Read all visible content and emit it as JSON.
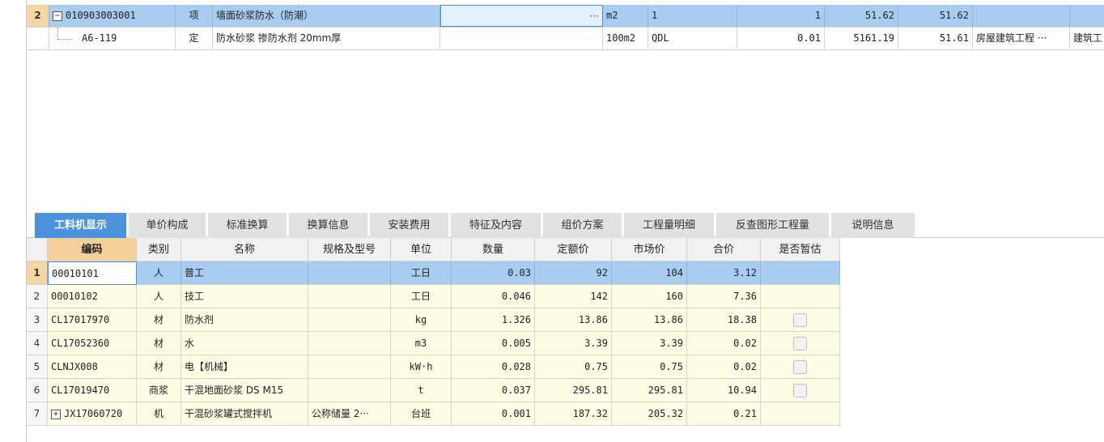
{
  "top_rows": [
    {
      "row_no": "2",
      "code": "010903003001",
      "type": "项",
      "name": "墙面砂浆防水（防潮）",
      "spec": "",
      "edit_button": "···",
      "unit": "m2",
      "expr": "1",
      "qty": "1",
      "unit_price": "51.62",
      "total": "51.62",
      "category": "",
      "extra": ""
    },
    {
      "row_no": "",
      "code": "A6-119",
      "type": "定",
      "name": "防水砂浆 掺防水剂 20mm厚",
      "spec": "",
      "unit": "100m2",
      "expr": "QDL",
      "qty": "0.01",
      "unit_price": "5161.19",
      "total": "51.61",
      "category": "房屋建筑工程 ···",
      "extra": "建筑工"
    }
  ],
  "tabs": [
    "工料机显示",
    "单价构成",
    "标准换算",
    "换算信息",
    "安装费用",
    "特征及内容",
    "组价方案",
    "工程量明细",
    "反查图形工程量",
    "说明信息"
  ],
  "active_tab": "工料机显示",
  "table": {
    "headers": [
      "编码",
      "类别",
      "名称",
      "规格及型号",
      "单位",
      "数量",
      "定额价",
      "市场价",
      "合价",
      "是否暂估"
    ],
    "rows": [
      {
        "no": "1",
        "code": "00010101",
        "cat": "人",
        "name": "普工",
        "spec": "",
        "unit": "工日",
        "qty": "0.03",
        "base": "92",
        "market": "104",
        "total": "3.12",
        "checkbox": false,
        "expand": false
      },
      {
        "no": "2",
        "code": "00010102",
        "cat": "人",
        "name": "技工",
        "spec": "",
        "unit": "工日",
        "qty": "0.046",
        "base": "142",
        "market": "160",
        "total": "7.36",
        "checkbox": false,
        "expand": false
      },
      {
        "no": "3",
        "code": "CL17017970",
        "cat": "材",
        "name": "防水剂",
        "spec": "",
        "unit": "kg",
        "qty": "1.326",
        "base": "13.86",
        "market": "13.86",
        "total": "18.38",
        "checkbox": true,
        "expand": false
      },
      {
        "no": "4",
        "code": "CL17052360",
        "cat": "材",
        "name": "水",
        "spec": "",
        "unit": "m3",
        "qty": "0.005",
        "base": "3.39",
        "market": "3.39",
        "total": "0.02",
        "checkbox": true,
        "expand": false
      },
      {
        "no": "5",
        "code": "CLNJX008",
        "cat": "材",
        "name": "电【机械】",
        "spec": "",
        "unit": "kW·h",
        "qty": "0.028",
        "base": "0.75",
        "market": "0.75",
        "total": "0.02",
        "checkbox": true,
        "expand": false
      },
      {
        "no": "6",
        "code": "CL17019470",
        "cat": "商浆",
        "name": "干混地面砂浆 DS M15",
        "spec": "",
        "unit": "t",
        "qty": "0.037",
        "base": "295.81",
        "market": "295.81",
        "total": "10.94",
        "checkbox": true,
        "expand": false
      },
      {
        "no": "7",
        "code": "JX17060720",
        "cat": "机",
        "name": "干混砂浆罐式搅拌机",
        "spec": "公称储量 2···",
        "unit": "台班",
        "qty": "0.001",
        "base": "187.32",
        "market": "205.32",
        "total": "0.21",
        "checkbox": false,
        "expand": true
      }
    ]
  },
  "colors": {
    "selected_row": "#a9cdf1",
    "active_tab": "#4a92dc",
    "row_bg": "#fdfde6",
    "header_highlight": "#f6d09a"
  },
  "icons": {
    "expand": "plus-box-icon",
    "collapse": "minus-box-icon"
  }
}
